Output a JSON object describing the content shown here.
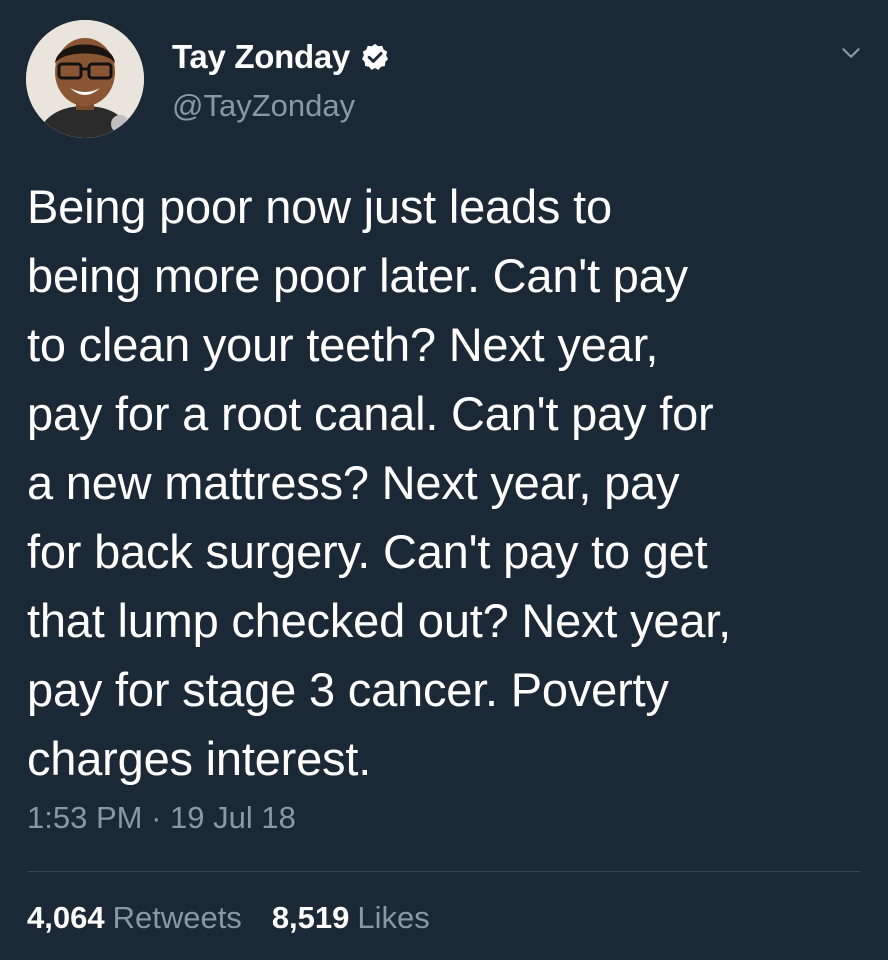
{
  "author": {
    "display_name": "Tay Zonday",
    "handle": "@TayZonday",
    "verified": true,
    "avatar_icon": "user-avatar-photo"
  },
  "tweet": {
    "text": "Being poor now just leads to\nbeing more poor later. Can't pay\nto clean your teeth? Next year,\npay for a root canal. Can't pay for\na new mattress? Next year, pay\nfor back surgery. Can't pay to get\nthat lump checked out? Next year,\npay for stage 3 cancer. Poverty\ncharges interest.",
    "time": "1:53 PM",
    "separator": "·",
    "date": "19 Jul 18"
  },
  "stats": {
    "retweets_count": "4,064",
    "retweets_label": "Retweets",
    "likes_count": "8,519",
    "likes_label": "Likes"
  },
  "colors": {
    "background": "#1b2836",
    "text": "#ffffff",
    "secondary_text": "#8899a6",
    "divider": "#38444d"
  },
  "icons": {
    "verified": "verified-badge-icon",
    "menu": "chevron-down-icon"
  }
}
